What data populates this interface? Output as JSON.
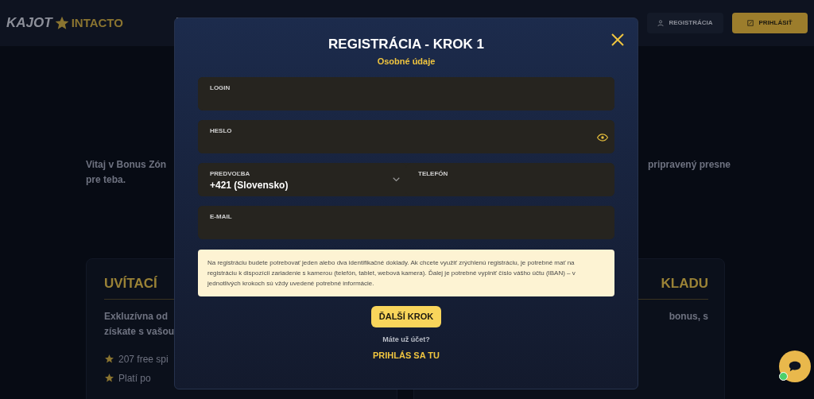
{
  "header": {
    "logo": {
      "left": "KAJOT",
      "right": "INTACTO"
    },
    "register_button": "REGISTRÁCIA",
    "login_button": "PRIHLÁSIŤ"
  },
  "page": {
    "intro_left": [
      "Vitaj v Bonus Zón",
      "pre teba."
    ],
    "intro_right": "pripravený presne",
    "cards": [
      {
        "heading": "UVÍTACÍ",
        "text": [
          "Exkluzívna od",
          "získate s vašou"
        ],
        "bullets": [
          "207 free spi",
          "Platí po"
        ]
      },
      {
        "heading": "KLADU",
        "text": [
          "bonus, s"
        ]
      }
    ]
  },
  "modal": {
    "title": "REGISTRÁCIA - KROK 1",
    "subtitle": "Osobné údaje",
    "rows": [
      {
        "fields": [
          {
            "kind": "text",
            "label": "LOGIN"
          }
        ]
      },
      {
        "fields": [
          {
            "kind": "password",
            "label": "HESLO"
          }
        ]
      },
      {
        "fields": [
          {
            "kind": "select",
            "label": "PREDVOĽBA",
            "value": "+421 (Slovensko)"
          },
          {
            "kind": "text",
            "label": "TELEFÓN"
          }
        ]
      },
      {
        "fields": [
          {
            "kind": "text",
            "label": "E-MAIL"
          }
        ]
      }
    ],
    "notice": "Na registráciu budete potrebovať jeden alebo dva identifikačné doklady. Ak chcete využiť zrýchlenú registráciu, je potrebné mať na registráciu k dispozícii zariadenie s kamerou (telefón, tablet, webová kamera). Ďalej je potrebné vyplniť číslo vášho účtu (IBAN) – v jednotlivých krokoch sú vždy uvedené potrebné informácie.",
    "next_button": "ĎALŠÍ KROK",
    "account_question": "Máte už účet?",
    "login_link": "PRIHLÁS SA TU"
  }
}
